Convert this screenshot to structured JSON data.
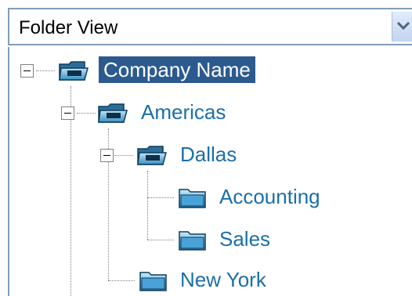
{
  "dropdown": {
    "value": "Folder View",
    "arrow_icon": "chevron-down-icon"
  },
  "tree": {
    "nodes": [
      {
        "label": "Company Name",
        "icon": "folder-open-icon",
        "expanded": true,
        "selected": true,
        "level": 0
      },
      {
        "label": "Americas",
        "icon": "folder-open-icon",
        "expanded": true,
        "selected": false,
        "level": 1
      },
      {
        "label": "Dallas",
        "icon": "folder-open-icon",
        "expanded": true,
        "selected": false,
        "level": 2
      },
      {
        "label": "Accounting",
        "icon": "folder-closed-icon",
        "expanded": false,
        "selected": false,
        "level": 3
      },
      {
        "label": "Sales",
        "icon": "folder-closed-icon",
        "expanded": false,
        "selected": false,
        "level": 3
      },
      {
        "label": "New York",
        "icon": "folder-closed-icon",
        "expanded": false,
        "selected": false,
        "level": 2
      }
    ]
  },
  "colors": {
    "link": "#1a6fa8",
    "selected_bg": "#2c5a8f",
    "border": "#7f9db9"
  }
}
